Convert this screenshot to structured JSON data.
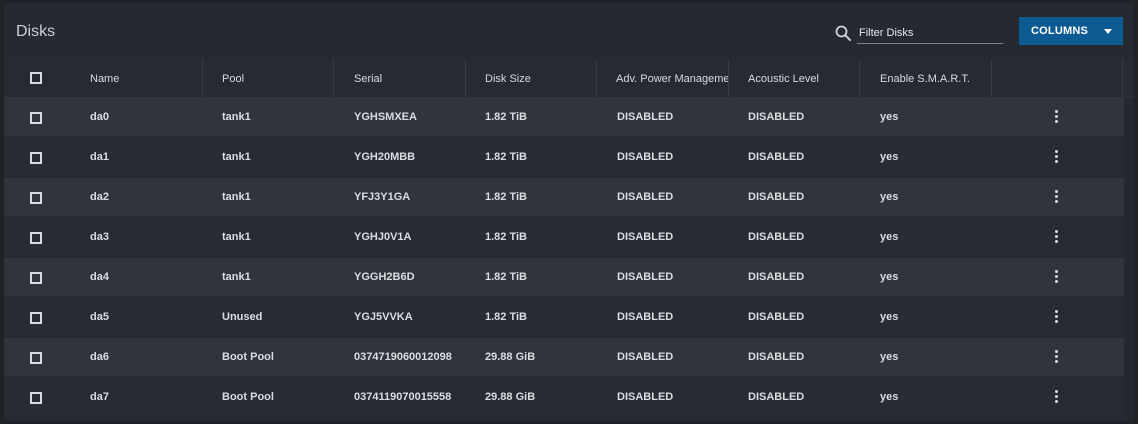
{
  "header": {
    "title": "Disks",
    "search": {
      "placeholder": "Filter Disks",
      "value": "",
      "icon": "search-icon"
    },
    "columns_button": {
      "label": "COLUMNS",
      "icon": "caret-down-icon"
    }
  },
  "table": {
    "columns": [
      "Name",
      "Pool",
      "Serial",
      "Disk Size",
      "Adv. Power Management",
      "Acoustic Level",
      "Enable S.M.A.R.T."
    ],
    "rows": [
      {
        "name": "da0",
        "pool": "tank1",
        "serial": "YGHSMXEA",
        "disk_size": "1.82 TiB",
        "adv_power": "DISABLED",
        "acoustic": "DISABLED",
        "smart": "yes"
      },
      {
        "name": "da1",
        "pool": "tank1",
        "serial": "YGH20MBB",
        "disk_size": "1.82 TiB",
        "adv_power": "DISABLED",
        "acoustic": "DISABLED",
        "smart": "yes"
      },
      {
        "name": "da2",
        "pool": "tank1",
        "serial": "YFJ3Y1GA",
        "disk_size": "1.82 TiB",
        "adv_power": "DISABLED",
        "acoustic": "DISABLED",
        "smart": "yes"
      },
      {
        "name": "da3",
        "pool": "tank1",
        "serial": "YGHJ0V1A",
        "disk_size": "1.82 TiB",
        "adv_power": "DISABLED",
        "acoustic": "DISABLED",
        "smart": "yes"
      },
      {
        "name": "da4",
        "pool": "tank1",
        "serial": "YGGH2B6D",
        "disk_size": "1.82 TiB",
        "adv_power": "DISABLED",
        "acoustic": "DISABLED",
        "smart": "yes"
      },
      {
        "name": "da5",
        "pool": "Unused",
        "serial": "YGJ5VVKA",
        "disk_size": "1.82 TiB",
        "adv_power": "DISABLED",
        "acoustic": "DISABLED",
        "smart": "yes"
      },
      {
        "name": "da6",
        "pool": "Boot Pool",
        "serial": "0374719060012098",
        "disk_size": "29.88 GiB",
        "adv_power": "DISABLED",
        "acoustic": "DISABLED",
        "smart": "yes"
      },
      {
        "name": "da7",
        "pool": "Boot Pool",
        "serial": "0374119070015558",
        "disk_size": "29.88 GiB",
        "adv_power": "DISABLED",
        "acoustic": "DISABLED",
        "smart": "yes"
      }
    ]
  },
  "colors": {
    "background": "#1e2328",
    "card": "#242a30",
    "row_odd": "#2f353b",
    "row_even": "#262c32",
    "accent": "#0e5b93",
    "text": "#d9dde2"
  }
}
